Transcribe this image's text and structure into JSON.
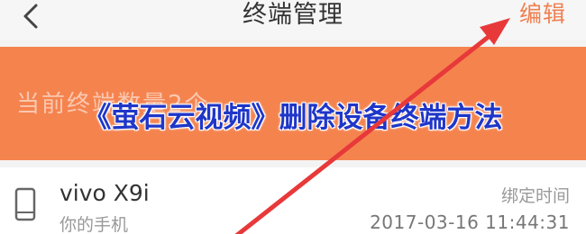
{
  "header": {
    "title": "终端管理",
    "edit_label": "编辑",
    "back_icon": "chevron-left-icon"
  },
  "banner": {
    "text": "当前终端数量2个"
  },
  "caption": {
    "text": "《萤石云视频》删除设备终端方法"
  },
  "device": {
    "icon": "phone-icon",
    "name": "vivo X9i",
    "subtitle": "你的手机",
    "bind_label": "绑定时间",
    "bind_time": "2017-03-16 11:44:31"
  },
  "colors": {
    "accent": "#f5834e",
    "edit": "#f08050",
    "arrow": "#e8393a",
    "caption": "#1f36c8"
  }
}
